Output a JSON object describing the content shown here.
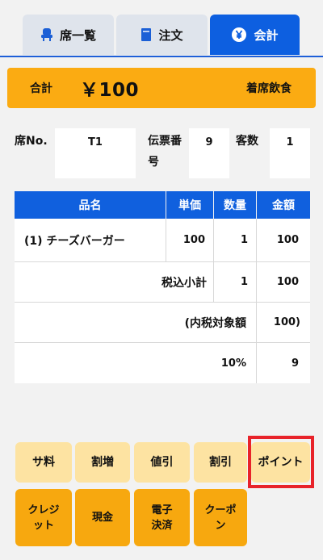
{
  "tabs": [
    {
      "label": "席一覧",
      "icon": "seat-icon",
      "active": false
    },
    {
      "label": "注文",
      "icon": "order-book-icon",
      "active": false
    },
    {
      "label": "会計",
      "icon": "yen-icon",
      "active": true
    }
  ],
  "summary": {
    "total_label": "合計",
    "total_amount": "￥100",
    "mode": "着席飲食"
  },
  "info": {
    "seat_label": "席No.",
    "seat_value": "T1",
    "slip_label": "伝票番号",
    "slip_value": "9",
    "guests_label": "客数",
    "guests_value": "1"
  },
  "table": {
    "headers": [
      "品名",
      "単価",
      "数量",
      "金額"
    ],
    "items": [
      {
        "name": "(1) チーズバーガー",
        "price": "100",
        "qty": "1",
        "amount": "100"
      }
    ],
    "subtotal_label": "税込小計",
    "subtotal_qty": "1",
    "subtotal_amount": "100",
    "taxable_label": "(内税対象額",
    "taxable_amount": "100)",
    "tax_rate": "10%",
    "tax_amount": "9"
  },
  "buttons": {
    "row1": [
      "サ料",
      "割増",
      "値引",
      "割引",
      "ポイント"
    ],
    "row2": [
      "クレジット",
      "現金",
      "電子決済",
      "クーポン"
    ]
  },
  "colors": {
    "accent_blue": "#0d5fe0",
    "summary_orange": "#fbab12",
    "light_button": "#fde3a2",
    "dark_button": "#f7a80f",
    "highlight_red": "#e8232a"
  }
}
